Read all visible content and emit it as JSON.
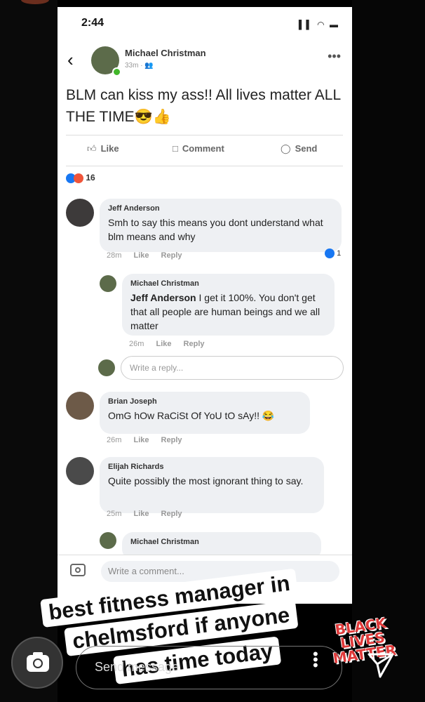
{
  "status_bar": {
    "time": "2:44",
    "icons": "▌▌ ◠ ▬"
  },
  "post": {
    "author": "Michael Christman",
    "meta": "33m · 👥",
    "text": "BLM can kiss my ass!! All lives matter ALL THE TIME😎👍",
    "actions": {
      "like": "Like",
      "comment": "Comment",
      "send": "Send"
    },
    "reaction_count": "16"
  },
  "comments": [
    {
      "name": "Jeff Anderson",
      "text": "Smh to say this means you dont understand what blm means and why",
      "time": "28m",
      "like": "Like",
      "reply": "Reply",
      "reactions": "1"
    },
    {
      "name": "Michael Christman",
      "mention": "Jeff Anderson",
      "text": " I get it 100%. You don't get that all people are human beings and we all matter",
      "time": "26m",
      "like": "Like",
      "reply": "Reply"
    },
    {
      "name": "Brian Joseph",
      "text": "OmG hOw RaCiSt Of YoU tO sAy!! 😂",
      "time": "26m",
      "like": "Like",
      "reply": "Reply"
    },
    {
      "name": "Elijah Richards",
      "text": "Quite possibly the most ignorant thing to say.",
      "time": "25m",
      "like": "Like",
      "reply": "Reply"
    },
    {
      "name": "Michael Christman"
    }
  ],
  "reply_placeholder": "Write a reply...",
  "comment_placeholder": "Write a comment...",
  "story_caption": {
    "line1": "best fitness manager in",
    "line2": "chelmsford if anyone",
    "line3": "has time today"
  },
  "sticker": {
    "line1": "BLACK",
    "line2": "LIVES",
    "line3": "MATTER"
  },
  "instagram": {
    "send_placeholder": "Send message"
  },
  "colors": {
    "facebook_blue": "#1877f2",
    "sticker_red": "#e03a3a",
    "bubble": "#eef0f3"
  }
}
